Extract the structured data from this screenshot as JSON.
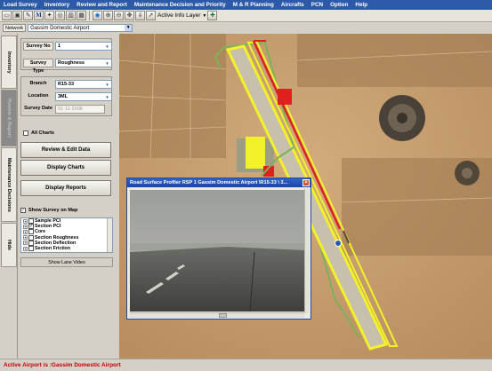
{
  "menu": [
    "Load Survey",
    "Inventory",
    "Review and Report",
    "Maintenance Decision and Priority",
    "M & R Planning",
    "Aircrafts",
    "PCN",
    "Option",
    "Help"
  ],
  "toolbar": {
    "m_button": "M",
    "active_layer_label": "Active Info Layer",
    "icons": [
      "window-icon",
      "save-icon",
      "edit-icon",
      "m-icon",
      "star-icon",
      "target-icon",
      "chart-icon",
      "grid-icon",
      "globe-icon",
      "zoom-in-icon",
      "zoom-out-icon",
      "pan-icon",
      "select-icon",
      "info-icon"
    ]
  },
  "network": {
    "label": "Network",
    "value": "Gassim Domestic Airport"
  },
  "side_tabs": [
    "Inventory",
    "Review & Report",
    "Maintenance Decisions",
    "Hide"
  ],
  "survey": {
    "survey_no_label": "Survey No",
    "survey_no_value": "1",
    "survey_type_label": "Survey Type",
    "survey_type_value": "Roughness",
    "branch_label": "Branch",
    "branch_value": "R15-33",
    "location_label": "Location",
    "location_value": "3ML",
    "survey_date_label": "Survey Date",
    "survey_date_value": "01-11-2008"
  },
  "all_charts_label": "All Charts",
  "buttons": {
    "review_edit": "Review & Edit Data",
    "display_charts": "Display Charts",
    "display_reports": "Display Reports",
    "show_lane_video": "Show Lane Video"
  },
  "show_survey_label": "Show Survey on Map",
  "layers": [
    {
      "label": "Sample PCI",
      "checked": false
    },
    {
      "label": "Section PCI",
      "checked": true
    },
    {
      "label": "Core",
      "checked": false
    },
    {
      "label": "Section Roughness",
      "checked": false
    },
    {
      "label": "Section Deflection",
      "checked": false
    },
    {
      "label": "Section Friction",
      "checked": false
    }
  ],
  "profiler": {
    "title": "Road Surface Profiler  RSP 1 Gassim Domestic Airport \\R15-33 \\ 3..."
  },
  "status": "Active Airport is :Gassim Domestic Airport",
  "colors": {
    "menu_bg": "#2d5aa8",
    "runway_yellow": "#f2f22a",
    "runway_red": "#e0201c",
    "status_red": "#c00000"
  }
}
